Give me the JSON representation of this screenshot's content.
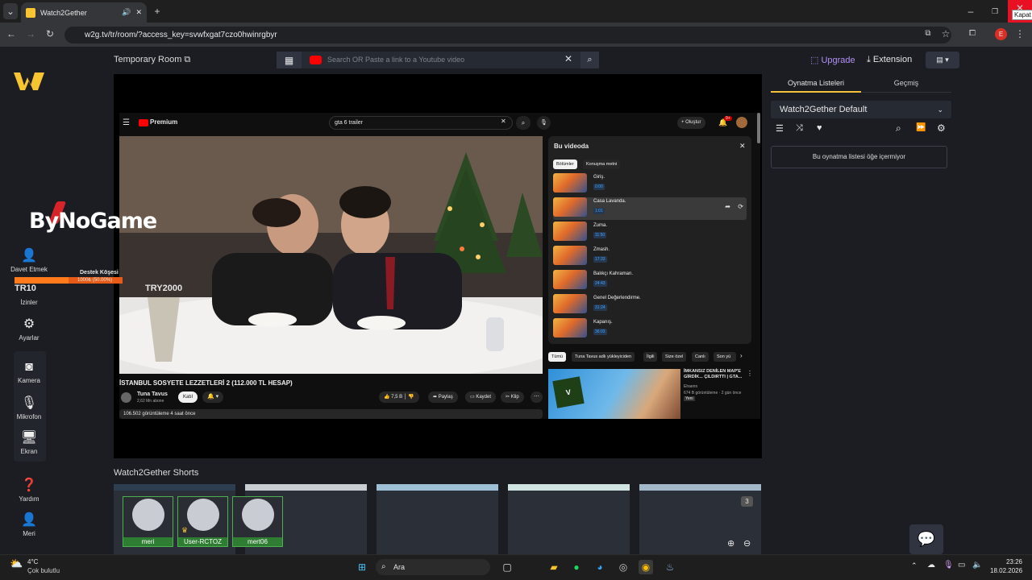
{
  "browser": {
    "tab_title": "Watch2Gether",
    "url": "w2g.tv/tr/room/?access_key=svwfxgat7czo0hwinrgbyr",
    "tooltip": "Kapat",
    "profile_letter": "E"
  },
  "room": {
    "title": "Temporary Room",
    "search_placeholder": "Search OR Paste a link to a Youtube video",
    "upgrade": "Upgrade",
    "extension": "Extension"
  },
  "sidebar": {
    "items": [
      {
        "label": "Davet Etmek",
        "icon": "add-user-icon"
      },
      {
        "label": "İzinler",
        "icon": "permissions-icon"
      },
      {
        "label": "Ayarlar",
        "icon": "gear-icon"
      },
      {
        "label": "Kamera",
        "icon": "camera-icon"
      },
      {
        "label": "Mikrofon",
        "icon": "mic-icon"
      },
      {
        "label": "Ekran",
        "icon": "monitor-icon"
      },
      {
        "label": "Yardım",
        "icon": "help-icon"
      },
      {
        "label": "Meri",
        "icon": "user-icon"
      }
    ]
  },
  "overlay": {
    "brand": "ByNoGame",
    "destek_title": "Destek Köşesi",
    "destek_progress": "1000₺ (50.00%)",
    "destek_progress_fraction": 0.5,
    "left_amount": "TR10",
    "right_amount": "TRY2000"
  },
  "youtube": {
    "logo": "Premium",
    "search": "gta 6 trailer",
    "create": "Oluştur",
    "notif_count": "9+",
    "video_title": "İSTANBUL SOSYETE LEZZETLERİ 2 (112.000 TL HESAP)",
    "channel": "Tuna Tavus",
    "subs": "2,62 Mn abone",
    "join": "Katıl",
    "likes": "7,5 B",
    "share": "Paylaş",
    "save": "Kaydet",
    "clip": "Klip",
    "views": "106.502 görüntüleme  4 saat önce",
    "chapters_title": "Bu videoda",
    "chapter_tabs": [
      "Bölümler",
      "Konuşma metni"
    ],
    "chapters": [
      {
        "title": "Giriş.",
        "time": "0:00"
      },
      {
        "title": "Casa Lavanda.",
        "time": "1:01"
      },
      {
        "title": "Zuma.",
        "time": "11:50"
      },
      {
        "title": "Zmash.",
        "time": "17:33"
      },
      {
        "title": "Balıkçı Kahraman.",
        "time": "24:43"
      },
      {
        "title": "Genel Değerlendirme.",
        "time": "31:24"
      },
      {
        "title": "Kapanış.",
        "time": "36:03"
      }
    ],
    "filter_pills": [
      "Tümü",
      "Tuna Tavus adlı yükleyiciden",
      "İlgili",
      "Size özel",
      "Canlı",
      "Son yü"
    ],
    "rec": {
      "title": "İMKANSIZ DENİLEN MAP'E GİRDİK... ÇILDIRTTI | GTA...",
      "channel": "Elraenn",
      "meta": "674 B görüntüleme · 2 gün önce",
      "badge": "Yeni"
    }
  },
  "right": {
    "tabs": [
      "Oynatma Listeleri",
      "Geçmiş"
    ],
    "playlist": "Watch2Gether Default",
    "empty": "Bu oynatma listesi öğe içermiyor"
  },
  "shorts": {
    "title": "Watch2Gether Shorts",
    "count": "3"
  },
  "users": [
    "meri",
    "User-RCTOZ",
    "mert06"
  ],
  "taskbar": {
    "temp": "4°C",
    "weather": "Çok bulutlu",
    "search": "Ara",
    "time": "23:26",
    "date": "18.02.2026"
  }
}
